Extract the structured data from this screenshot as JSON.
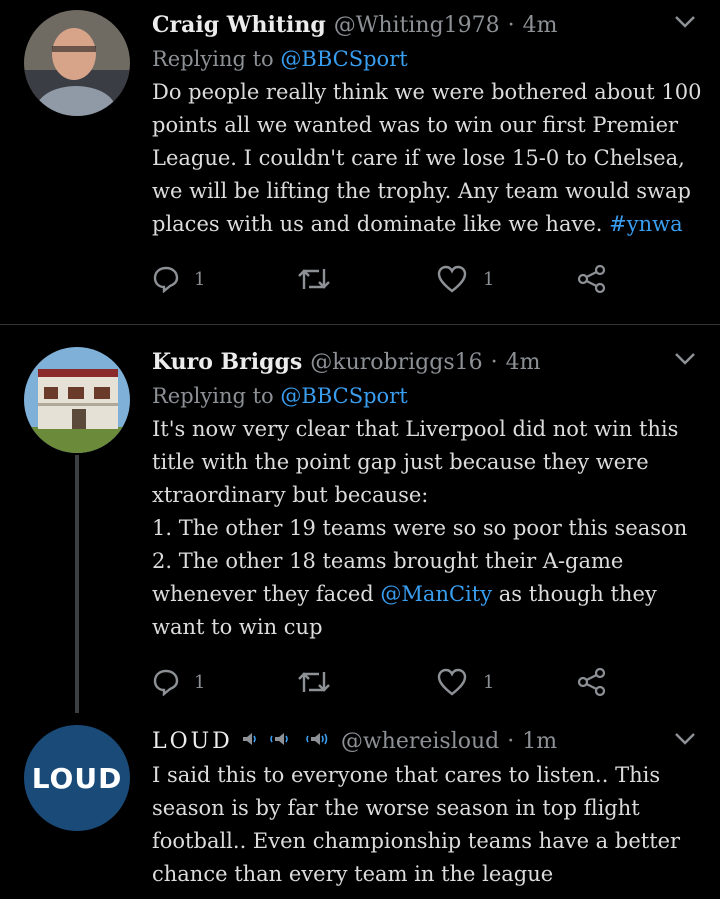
{
  "tweets": [
    {
      "name": "Craig Whiting",
      "handle": "@Whiting1978",
      "time": "4m",
      "replying_prefix": "Replying to",
      "replying_to": "@BBCSport",
      "text_main": "Do people really think we were bothered about 100 points all we wanted was to win our first Premier League. I couldn't care if we lose 15-0 to Chelsea, we will be lifting the trophy. Any team would swap places with us and dominate like we have. ",
      "hashtag": "#ynwa",
      "reply_count": "1",
      "retweet_count": "",
      "like_count": "1"
    },
    {
      "name": "Kuro Briggs",
      "handle": "@kurobriggs16",
      "time": "4m",
      "replying_prefix": "Replying to",
      "replying_to": "@BBCSport",
      "text_part1": "It's now very clear that Liverpool did not win this title with the point gap just because they were xtraordinary but because:\n1. The other 19 teams were so so poor this season\n2. The other 18 teams brought their A-game whenever they faced ",
      "mention": "@ManCity",
      "text_part2": " as though they want to win cup",
      "reply_count": "1",
      "retweet_count": "",
      "like_count": "1"
    },
    {
      "name": "LOUD",
      "handle": "@whereisloud",
      "time": "1m",
      "avatar_text": "LOUD",
      "text": "I said this to everyone that cares to listen.. This season is by far the worse season in top flight football.. Even championship teams have a better chance than every team in the league"
    }
  ],
  "colors": {
    "background": "#000000",
    "link": "#3a9ef0",
    "muted": "#8d9196",
    "separator": "#2f3336"
  },
  "icons": [
    "reply-icon",
    "retweet-icon",
    "like-icon",
    "share-icon",
    "chevron-down-icon",
    "speaker-icon"
  ]
}
